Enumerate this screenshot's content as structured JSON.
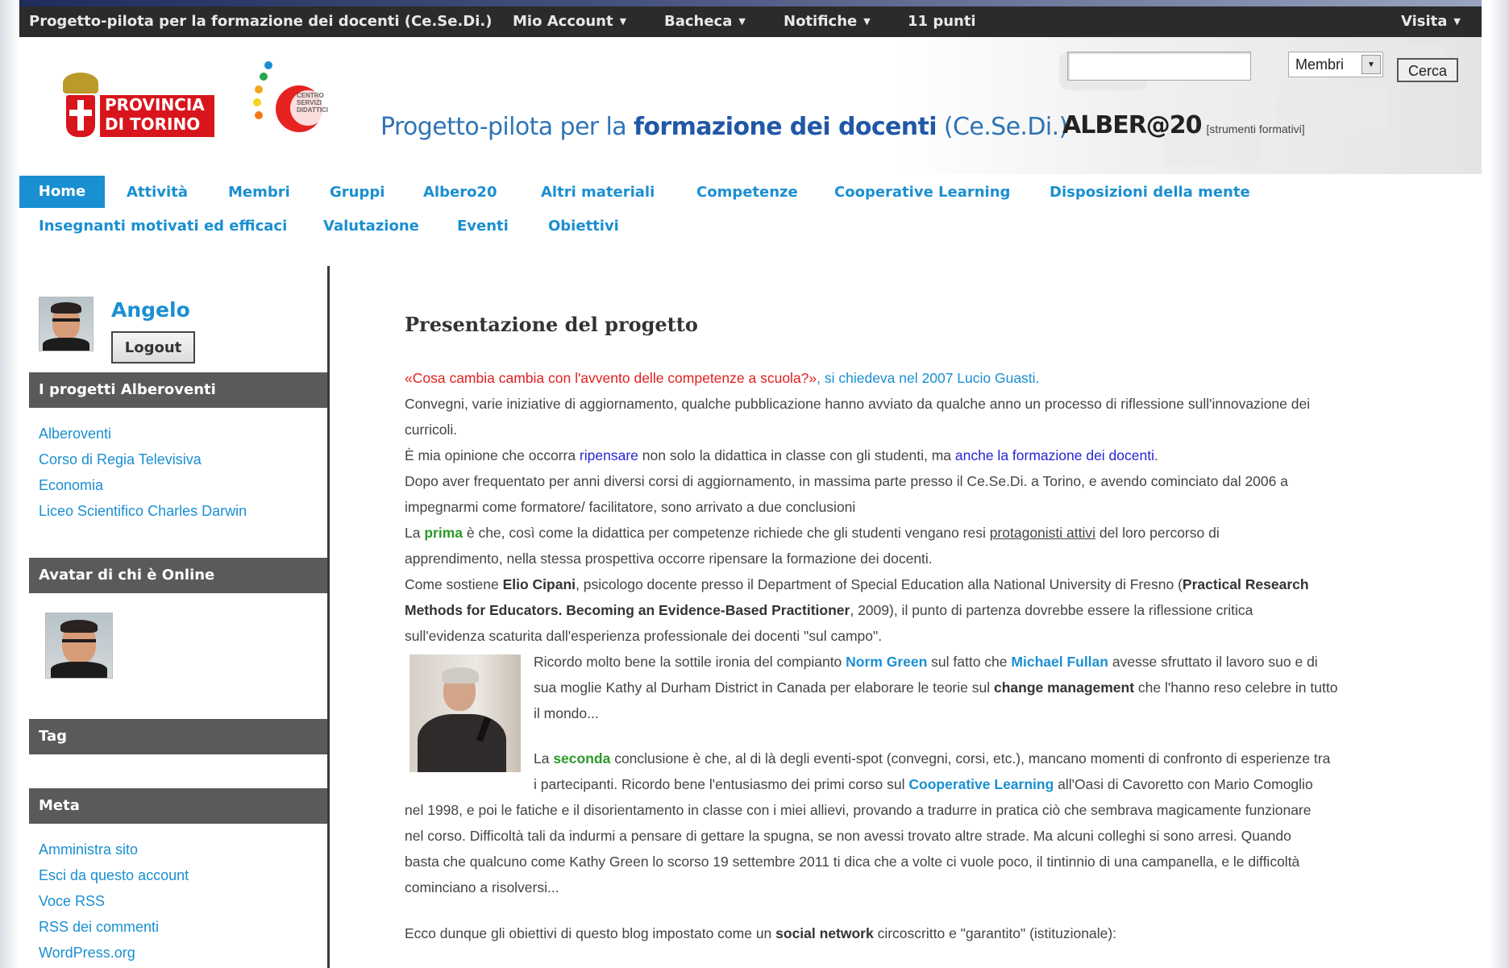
{
  "admin_bar": {
    "site_name": "Progetto-pilota per la formazione dei docenti (Ce.Se.Di.)",
    "my_account": "Mio Account",
    "dashboard": "Bacheca",
    "notifications": "Notifiche",
    "points": "11 punti",
    "visit": "Visita"
  },
  "header": {
    "logo_province_text_1": "PROVINCIA",
    "logo_province_text_2": "DI TORINO",
    "logo_cesedi_text": "CENTRO SERVIZI DIDATTICI",
    "title_pre": "Progetto-pilota per la ",
    "title_bold": "formazione dei docenti",
    "title_post": " (Ce.Se.Di.)",
    "albero_logo": "ALBER@20",
    "albero_tag": "[strumenti formativi]",
    "search_value": "",
    "search_scope": "Membri",
    "search_button": "Cerca"
  },
  "nav": {
    "row1": [
      "Home",
      "Attività",
      "Membri",
      "Gruppi",
      "Albero20",
      "Altri materiali",
      "Competenze",
      "Cooperative Learning",
      "Disposizioni della mente"
    ],
    "row2": [
      "Insegnanti motivati ed efficaci",
      "Valutazione",
      "Eventi",
      "Obiettivi"
    ]
  },
  "sidebar": {
    "user_name": "Angelo",
    "logout": "Logout",
    "projects_title": "I progetti Alberoventi",
    "projects": [
      "Alberoventi",
      "Corso di Regia Televisiva",
      "Economia",
      "Liceo Scientifico Charles Darwin"
    ],
    "online_title": "Avatar di chi è Online",
    "tag_title": "Tag",
    "meta_title": "Meta",
    "meta_links": [
      "Amministra sito",
      "Esci da questo account",
      "Voce RSS",
      "RSS dei commenti",
      "WordPress.org"
    ]
  },
  "content": {
    "heading": "Presentazione del progetto",
    "l1_quote": "«Cosa cambia cambia con l'avvento delle competenze a scuola?»",
    "l1_rest": ", si chiedeva nel 2007 Lucio Guasti.",
    "l2": "Convegni, varie iniziative di aggiornamento, qualche pubblicazione hanno avviato da qualche anno un processo di riflessione sull'innovazione dei",
    "l3": "curricoli.",
    "l4_a": "È mia opinione che occorra ",
    "l4_link1": "ripensare",
    "l4_b": " non solo la didattica in classe con gli studenti, ma ",
    "l4_link2": "anche la formazione dei docenti",
    "l4_c": ".",
    "l5": "Dopo aver frequentato per anni diversi corsi di aggiornamento, in massima parte presso il Ce.Se.Di. a Torino, e avendo cominciato dal 2006 a",
    "l6": "impegnarmi come formatore/ facilitatore, sono arrivato a due conclusioni",
    "l7_a": "La ",
    "l7_b": "prima",
    "l7_c": " è che, così come la didattica per competenze richiede che gli studenti vengano resi ",
    "l7_d": "protagonisti attivi",
    "l7_e": " del loro percorso di",
    "l8": "apprendimento, nella stessa prospettiva occorre ripensare la formazione dei docenti.",
    "l9_a": "Come sostiene ",
    "l9_b": "Elio Cipani",
    "l9_c": ", psicologo docente presso il Department of Special Education alla National University di Fresno (",
    "l9_d": "Practical Research",
    "l10_a": "Methods for Educators. Becoming an Evidence-Based Practitioner",
    "l10_b": ", 2009), il punto di partenza dovrebbe essere la riflessione critica",
    "l11": "sull'evidenza scaturita dall'esperienza professionale dei docenti \"sul campo\".",
    "l12_a": "Ricordo molto bene la sottile ironia del compianto ",
    "l12_b": "Norm Green",
    "l12_c": " sul fatto che ",
    "l12_d": "Michael Fullan",
    "l12_e": " avesse sfruttato il lavoro suo e di",
    "l13_a": "sua moglie Kathy al Durham District in Canada per elaborare le teorie sul ",
    "l13_b": "change management",
    "l13_c": " che l'hanno reso celebre in tutto",
    "l14": "il mondo...",
    "l15_a": "La ",
    "l15_b": "seconda",
    "l15_c": " conclusione è che, al di là degli eventi-spot (convegni, corsi, etc.), mancano momenti di confronto di esperienze tra",
    "l16_a": "i partecipanti. Ricordo bene l'entusiasmo dei primi corso sul ",
    "l16_b": "Cooperative Learning",
    "l16_c": " all'Oasi di Cavoretto con Mario Comoglio",
    "l17": "nel 1998, e poi le fatiche e il disorientamento in classe con i miei allievi, provando a tradurre in pratica ciò che sembrava magicamente funzionare",
    "l18": "nel corso. Difficoltà tali da indurmi a pensare di gettare la spugna, se non avessi trovato altre strade. Ma alcuni colleghi si sono arresi. Quando",
    "l19": "basta che qualcuno come Kathy Green lo scorso 19 settembre 2011 ti dica che a volte ci vuole poco, il tintinnio di una campanella, e le difficoltà",
    "l20": "cominciano a risolversi...",
    "l21_a": "Ecco dunque gli obiettivi di questo blog impostato come un ",
    "l21_b": "social network",
    "l21_c": " circoscritto e \"garantito\" (istituzionale):"
  }
}
